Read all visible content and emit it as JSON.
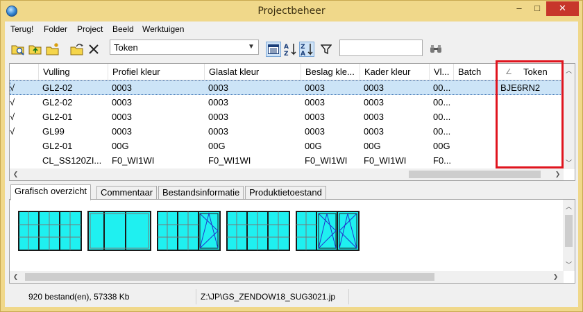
{
  "window": {
    "title": "Projectbeheer",
    "minimize": "–",
    "maximize": "□",
    "close": "✕"
  },
  "menu": [
    "Terug!",
    "Folder",
    "Project",
    "Beeld",
    "Werktuigen"
  ],
  "toolbar": {
    "combo_value": "Token",
    "search_value": "",
    "icons": [
      "open-folder-icon",
      "folder-up-icon",
      "new-folder-icon",
      "open-file-icon",
      "delete-icon",
      "details-view-icon",
      "sort-az-icon",
      "sort-za-icon",
      "filter-icon",
      "binoculars-icon"
    ]
  },
  "grid": {
    "columns": [
      "",
      "Vulling",
      "Profiel kleur",
      "Glaslat kleur",
      "Beslag kle...",
      "Kader kleur",
      "Vl...",
      "Batch",
      "Token"
    ],
    "rows": [
      [
        "√",
        "GL2-02",
        "0003",
        "0003",
        "0003",
        "0003",
        "00...",
        "",
        "BJE6RN2"
      ],
      [
        "√",
        "GL2-02",
        "0003",
        "0003",
        "0003",
        "0003",
        "00...",
        "",
        ""
      ],
      [
        "√",
        "GL2-01",
        "0003",
        "0003",
        "0003",
        "0003",
        "00...",
        "",
        ""
      ],
      [
        "√",
        "GL99",
        "0003",
        "0003",
        "0003",
        "0003",
        "00...",
        "",
        ""
      ],
      [
        "",
        "GL2-01",
        "00G",
        "00G",
        "00G",
        "00G",
        "00G",
        "",
        ""
      ],
      [
        "",
        "CL_SS120ZI...",
        "F0_WI1WI",
        "F0_WI1WI",
        "F0_WI1WI",
        "F0_WI1WI",
        "F0...",
        "",
        ""
      ]
    ],
    "sort_indicator": "∠",
    "highlight_color": "#e0141e",
    "selected_row_color": "#cce4f7"
  },
  "tabs": [
    "Grafisch overzicht",
    "Commentaar",
    "Bestandsinformatie",
    "Produktietoestand"
  ],
  "preview": {
    "glass_color": "#1ff0f0",
    "frame_color": "#1a1a1a",
    "sash_line_color": "#2233cc"
  },
  "status": {
    "count": "920 bestand(en), 57338 Kb",
    "path": "Z:\\JP\\GS_ZENDOW18_SUG3021.jp"
  }
}
